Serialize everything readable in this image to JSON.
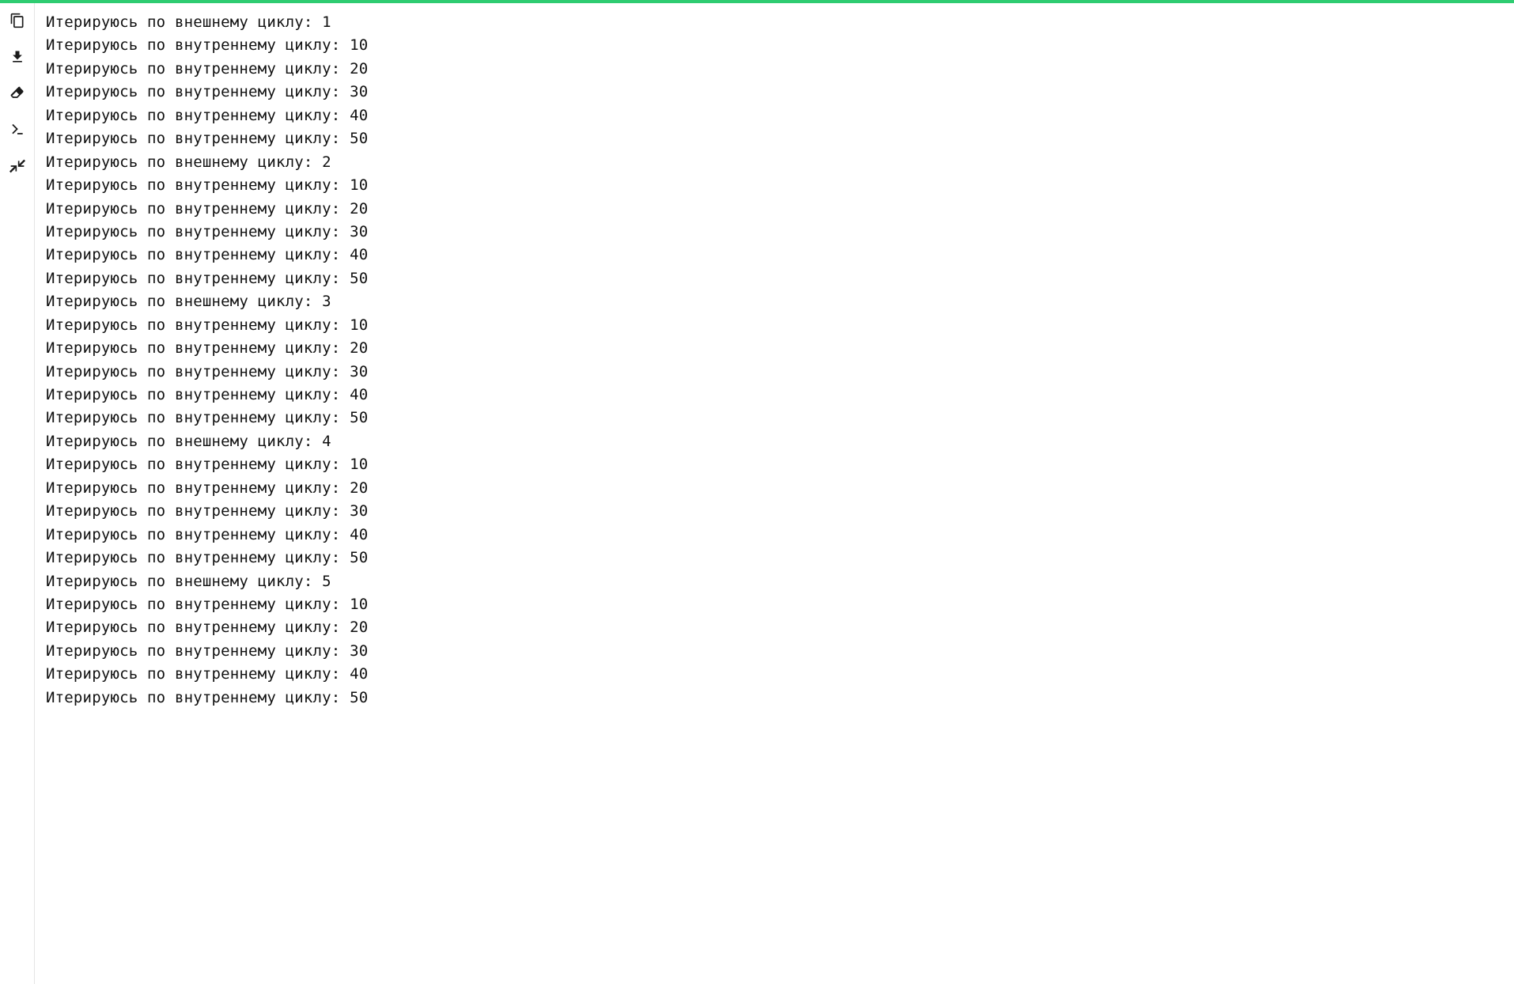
{
  "colors": {
    "accent": "#2ecc71",
    "text": "#1a1a1a",
    "bg": "#ffffff"
  },
  "sidebar": {
    "items": [
      {
        "name": "copy-icon",
        "label": "Copy"
      },
      {
        "name": "download-icon",
        "label": "Download"
      },
      {
        "name": "erase-icon",
        "label": "Clear"
      },
      {
        "name": "terminal-icon",
        "label": "Terminal"
      },
      {
        "name": "collapse-icon",
        "label": "Collapse"
      }
    ]
  },
  "output": {
    "outer_prefix": "Итерируюсь по внешнему циклу: ",
    "inner_prefix": "Итерируюсь по внутреннему циклу: ",
    "outer_values": [
      1,
      2,
      3,
      4,
      5
    ],
    "inner_values": [
      10,
      20,
      30,
      40,
      50
    ],
    "lines": [
      "Итерируюсь по внешнему циклу: 1",
      "Итерируюсь по внутреннему циклу: 10",
      "Итерируюсь по внутреннему циклу: 20",
      "Итерируюсь по внутреннему циклу: 30",
      "Итерируюсь по внутреннему циклу: 40",
      "Итерируюсь по внутреннему циклу: 50",
      "Итерируюсь по внешнему циклу: 2",
      "Итерируюсь по внутреннему циклу: 10",
      "Итерируюсь по внутреннему циклу: 20",
      "Итерируюсь по внутреннему циклу: 30",
      "Итерируюсь по внутреннему циклу: 40",
      "Итерируюсь по внутреннему циклу: 50",
      "Итерируюсь по внешнему циклу: 3",
      "Итерируюсь по внутреннему циклу: 10",
      "Итерируюсь по внутреннему циклу: 20",
      "Итерируюсь по внутреннему циклу: 30",
      "Итерируюсь по внутреннему циклу: 40",
      "Итерируюсь по внутреннему циклу: 50",
      "Итерируюсь по внешнему циклу: 4",
      "Итерируюсь по внутреннему циклу: 10",
      "Итерируюсь по внутреннему циклу: 20",
      "Итерируюсь по внутреннему циклу: 30",
      "Итерируюсь по внутреннему циклу: 40",
      "Итерируюсь по внутреннему циклу: 50",
      "Итерируюсь по внешнему циклу: 5",
      "Итерируюсь по внутреннему циклу: 10",
      "Итерируюсь по внутреннему циклу: 20",
      "Итерируюсь по внутреннему циклу: 30",
      "Итерируюсь по внутреннему циклу: 40",
      "Итерируюсь по внутреннему циклу: 50"
    ]
  }
}
